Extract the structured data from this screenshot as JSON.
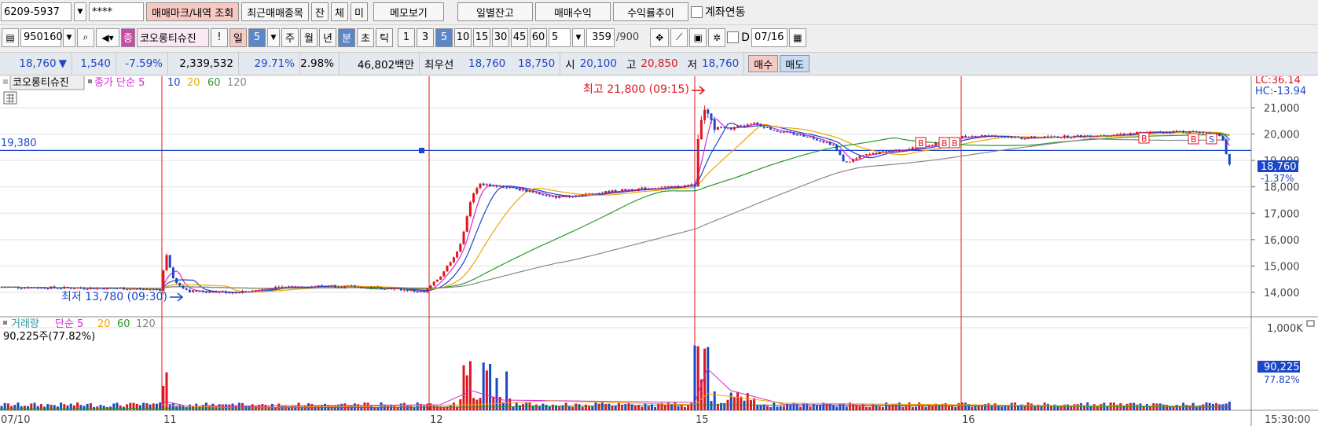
{
  "toolbar1": {
    "account": "6209-5937",
    "password": "****",
    "btn_trade_mark": "매매마크/내역 조회",
    "btn_recent": "최근매매종목",
    "btn_jan": "잔",
    "btn_che": "체",
    "btn_mi": "미",
    "btn_memo": "메모보기",
    "btn_daily": "일별잔고",
    "btn_profit": "매매수익",
    "btn_rate": "수익률추이",
    "link_label": "계좌연동"
  },
  "toolbar2": {
    "code": "950160",
    "badge": "종",
    "stock_name": "코오롱티슈진",
    "period_il": "일",
    "period_num": "5",
    "btn_ju": "주",
    "btn_wol": "월",
    "btn_nyeon": "년",
    "btn_bun": "분",
    "btn_cho": "초",
    "btn_tik": "틱",
    "intervals": [
      "1",
      "3",
      "5",
      "10",
      "15",
      "30",
      "45",
      "60"
    ],
    "interval_select": "5",
    "count": "359",
    "count_total": "/900",
    "d_label": "D",
    "date": "07/16"
  },
  "quote": {
    "price": "18,760",
    "arrow": "▼",
    "change": "1,540",
    "change_pct": "-7.59%",
    "volume": "2,339,532",
    "vol_ratio": "29.71%",
    "turnover": "2.98%",
    "amount": "46,802백만",
    "best_label": "최우선",
    "best_ask": "18,760",
    "best_bid": "18,750",
    "open_label": "시",
    "open": "20,100",
    "high_label": "고",
    "high": "20,850",
    "low_label": "저",
    "low": "18,760",
    "buy": "매수",
    "sell": "매도"
  },
  "chart_labels": {
    "stock_tag": "코오롱티슈진",
    "legend_close": "종가 단순 5",
    "ma": [
      "10",
      "20",
      "60",
      "120"
    ],
    "hline_value": "19,380",
    "max_label": "최고 21,800 (09:15)",
    "min_label": "최저 13,780 (09:30)",
    "lc": "LC:36.14",
    "hc": "HC:-13.94",
    "price_tag": "18,760",
    "price_pct": "-1.37%",
    "vol_legend": "거래량",
    "vol_ma": "단순 5",
    "vol_ma_nums": [
      "20",
      "60",
      "120"
    ],
    "vol_info": "90,225주(77.82%)",
    "vol_axis_max": "1,000K",
    "vol_tag": "90,225",
    "vol_pct": "77.82%",
    "x_labels": [
      "07/10",
      "11",
      "12",
      "15",
      "16"
    ],
    "x_right": "15:30:00",
    "y_ticks": [
      "21,000",
      "20,000",
      "19,000",
      "18,000",
      "17,000",
      "16,000",
      "15,000",
      "14,000"
    ],
    "markers": [
      "B",
      "B",
      "B",
      "B",
      "B",
      "B",
      "S"
    ]
  },
  "chart_data": {
    "type": "line",
    "title": "코오롱티슈진",
    "x": [
      "07/10",
      "11",
      "12",
      "15",
      "16"
    ],
    "series": [
      {
        "name": "종가",
        "values": [
          14200,
          14100,
          18100,
          20200,
          18760
        ]
      }
    ],
    "ylim": [
      13500,
      21800
    ],
    "high": 21800,
    "low": 13780,
    "hline": 19380
  },
  "colors": {
    "up": "#e0141e",
    "down": "#1c46c8",
    "ma5": "#d42cd4",
    "ma10": "#1c46c8",
    "ma20": "#f0a800",
    "ma60": "#2a9a2a",
    "ma120": "#888888"
  }
}
